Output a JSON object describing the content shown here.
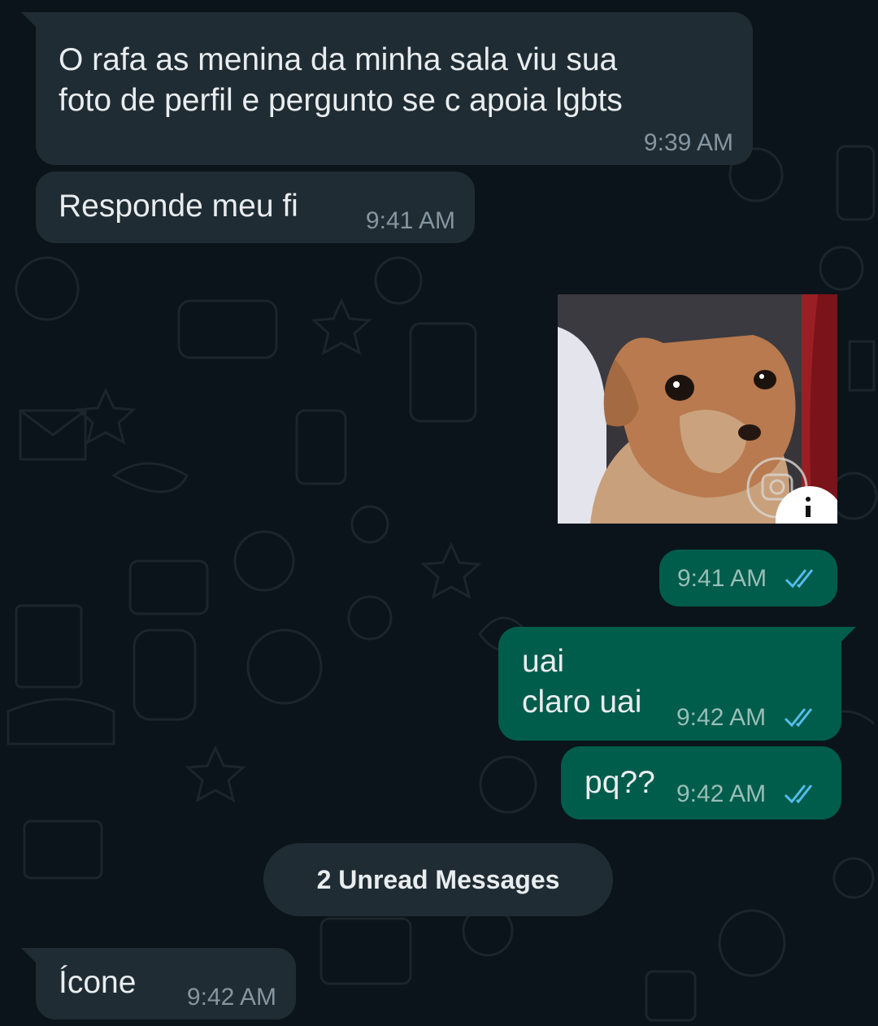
{
  "colors": {
    "background": "#0b141a",
    "incoming_bubble": "#202c33",
    "outgoing_bubble": "#005c4b",
    "read_ticks": "#53bdeb",
    "timestamp": "#8696a0"
  },
  "messages": [
    {
      "direction": "incoming",
      "text": "O rafa as menina da minha sala viu sua\nfoto de perfil e pergunto se c apoia lgbts",
      "time": "9:39 AM"
    },
    {
      "direction": "incoming",
      "text": "Responde meu fi",
      "time": "9:41 AM"
    },
    {
      "direction": "outgoing",
      "type": "image",
      "image_icon": "instagram-camera-icon",
      "time": "9:41 AM",
      "status": "read"
    },
    {
      "direction": "outgoing",
      "text": "uai\nclaro uai",
      "time": "9:42 AM",
      "status": "read"
    },
    {
      "direction": "outgoing",
      "text": "pq??",
      "time": "9:42 AM",
      "status": "read"
    },
    {
      "direction": "incoming",
      "text": "Ícone",
      "time": "9:42 AM"
    }
  ],
  "unread_banner": {
    "label": "2 Unread Messages"
  }
}
